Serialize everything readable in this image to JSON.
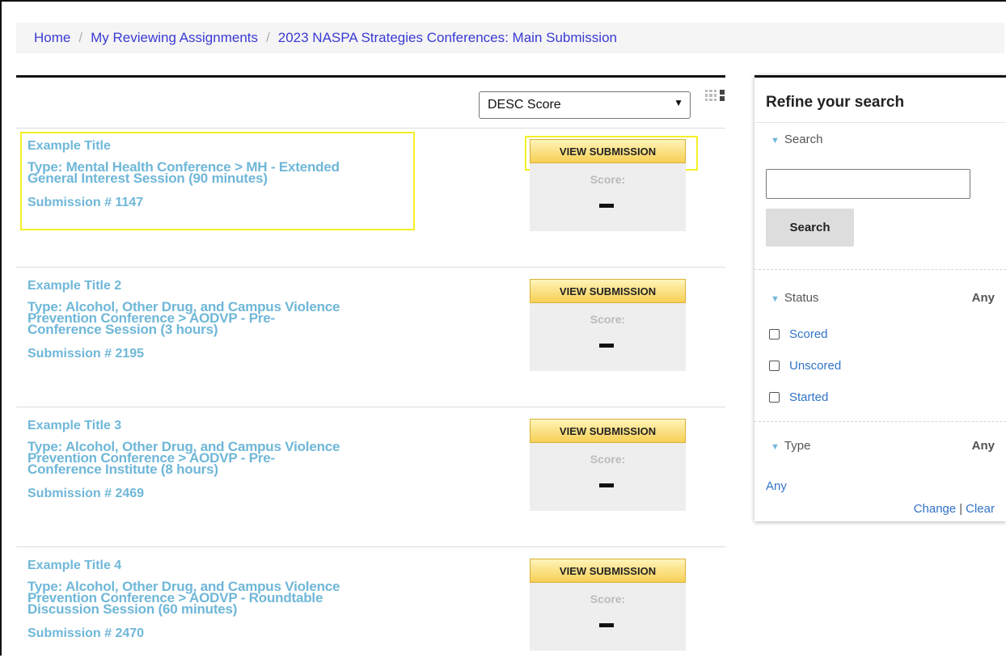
{
  "breadcrumb": [
    "Home",
    "My Reviewing Assignments",
    "2023 NASPA Strategies Conferences: Main Submission"
  ],
  "breadcrumb_separator": "/",
  "sort": {
    "selected": "DESC Score"
  },
  "submissions": [
    {
      "title": "Example Title",
      "type_lines": [
        "Type: Mental Health Conference > MH - Extended",
        "General Interest Session (90 minutes)"
      ],
      "number": "Submission # 1147",
      "button": "VIEW SUBMISSION",
      "score_label": "Score:",
      "score": "-"
    },
    {
      "title": "Example Title 2",
      "type_lines": [
        "Type: Alcohol, Other Drug, and Campus Violence",
        "Prevention Conference > AODVP - Pre-",
        "Conference Session (3 hours)"
      ],
      "number": "Submission # 2195",
      "button": "VIEW SUBMISSION",
      "score_label": "Score:",
      "score": "-"
    },
    {
      "title": "Example Title 3",
      "type_lines": [
        "Type: Alcohol, Other Drug, and Campus Violence",
        "Prevention Conference > AODVP - Pre-",
        "Conference Institute (8 hours)"
      ],
      "number": "Submission # 2469",
      "button": "VIEW SUBMISSION",
      "score_label": "Score:",
      "score": "-"
    },
    {
      "title": "Example Title 4",
      "type_lines": [
        "Type: Alcohol, Other Drug, and Campus Violence",
        "Prevention Conference > AODVP - Roundtable",
        "Discussion Session (60 minutes)"
      ],
      "number": "Submission # 2470",
      "button": "VIEW SUBMISSION",
      "score_label": "Score:",
      "score": "-"
    }
  ],
  "sidebar": {
    "title": "Refine your search",
    "search": {
      "label": "Search",
      "button": "Search",
      "value": ""
    },
    "status": {
      "label": "Status",
      "value": "Any",
      "options": [
        "Scored",
        "Unscored",
        "Started"
      ]
    },
    "type": {
      "label": "Type",
      "value": "Any",
      "selected": "Any",
      "change": "Change",
      "clear": "Clear",
      "divider": "|"
    }
  },
  "colors": {
    "link": "#6fb7d8",
    "highlight": "#f5ef26",
    "button": "#f7cf55",
    "breadcrumb_link": "#3a3ad6"
  }
}
